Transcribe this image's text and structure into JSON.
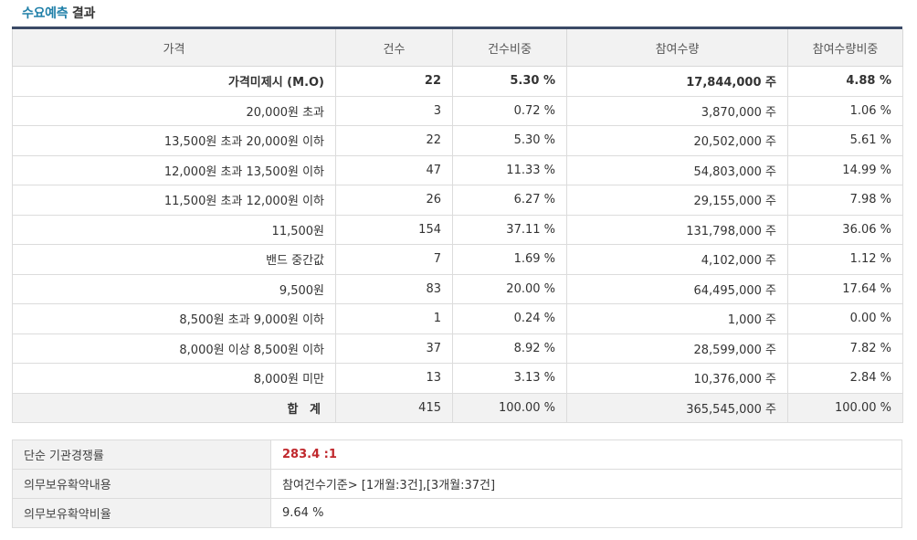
{
  "section": {
    "title_highlight": "수요예측",
    "title_rest": " 결과"
  },
  "table": {
    "headers": [
      "가격",
      "건수",
      "건수비중",
      "참여수량",
      "참여수량비중"
    ],
    "rows": [
      {
        "price": "가격미제시 (M.O)",
        "count": "22",
        "count_ratio": "5.30 %",
        "qty": "17,844,000 주",
        "qty_ratio": "4.88 %",
        "bold": true
      },
      {
        "price": "20,000원 초과",
        "count": "3",
        "count_ratio": "0.72 %",
        "qty": "3,870,000 주",
        "qty_ratio": "1.06 %"
      },
      {
        "price": "13,500원 초과 20,000원 이하",
        "count": "22",
        "count_ratio": "5.30 %",
        "qty": "20,502,000 주",
        "qty_ratio": "5.61 %"
      },
      {
        "price": "12,000원 초과 13,500원 이하",
        "count": "47",
        "count_ratio": "11.33 %",
        "qty": "54,803,000 주",
        "qty_ratio": "14.99 %"
      },
      {
        "price": "11,500원 초과 12,000원 이하",
        "count": "26",
        "count_ratio": "6.27 %",
        "qty": "29,155,000 주",
        "qty_ratio": "7.98 %"
      },
      {
        "price": "11,500원",
        "count": "154",
        "count_ratio": "37.11 %",
        "qty": "131,798,000 주",
        "qty_ratio": "36.06 %"
      },
      {
        "price": "밴드 중간값",
        "count": "7",
        "count_ratio": "1.69 %",
        "qty": "4,102,000 주",
        "qty_ratio": "1.12 %"
      },
      {
        "price": "9,500원",
        "count": "83",
        "count_ratio": "20.00 %",
        "qty": "64,495,000 주",
        "qty_ratio": "17.64 %"
      },
      {
        "price": "8,500원 초과 9,000원 이하",
        "count": "1",
        "count_ratio": "0.24 %",
        "qty": "1,000 주",
        "qty_ratio": "0.00 %"
      },
      {
        "price": "8,000원 이상 8,500원 이하",
        "count": "37",
        "count_ratio": "8.92 %",
        "qty": "28,599,000 주",
        "qty_ratio": "7.82 %"
      },
      {
        "price": "8,000원 미만",
        "count": "13",
        "count_ratio": "3.13 %",
        "qty": "10,376,000 주",
        "qty_ratio": "2.84 %"
      }
    ],
    "total": {
      "price": "합 계",
      "count": "415",
      "count_ratio": "100.00 %",
      "qty": "365,545,000 주",
      "qty_ratio": "100.00 %"
    }
  },
  "info": {
    "competition_label": "단순 기관경쟁률",
    "competition_value": "283.4 :1",
    "lockup_label": "의무보유확약내용",
    "lockup_value": "참여건수기준> [1개월:3건],[3개월:37건]",
    "lockup_ratio_label": "의무보유확약비율",
    "lockup_ratio_value": "9.64 %"
  }
}
